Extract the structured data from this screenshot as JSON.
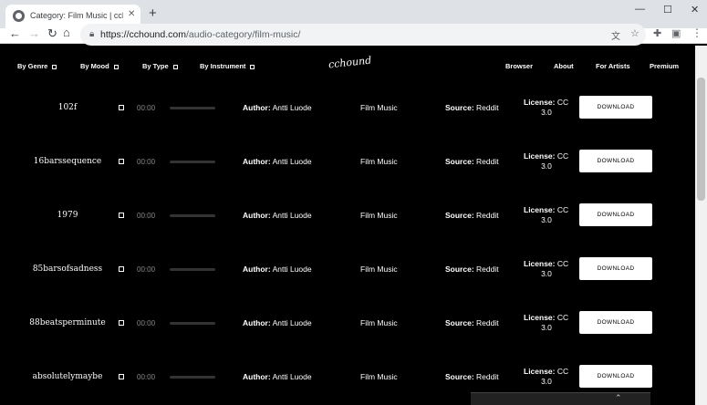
{
  "browser": {
    "tab_title": "Category: Film Music | cchound",
    "tab_close": "✕",
    "new_tab": "+",
    "url_host": "https://cchound.com",
    "url_path": "/audio-category/film-music/",
    "back": "←",
    "forward": "→",
    "reload": "↻",
    "home": "⌂",
    "minimize": "—",
    "maximize": "☐",
    "close": "✕",
    "translate_icon": "文",
    "star_icon": "☆",
    "extensions_icon": "✚",
    "profile_icon": "▣",
    "menu_icon": "⋮"
  },
  "site": {
    "logo": "cchound",
    "nav_left": [
      {
        "label": "By Genre"
      },
      {
        "label": "By Mood"
      },
      {
        "label": "By Type"
      },
      {
        "label": "By Instrument"
      }
    ],
    "nav_right": [
      {
        "label": "Browser"
      },
      {
        "label": "About"
      },
      {
        "label": "For Artists"
      },
      {
        "label": "Premium"
      }
    ],
    "tracks": [
      {
        "title": "102f",
        "time": "00:00",
        "author_label": "Author:",
        "author": "Antti Luode",
        "genre": "Film Music",
        "source_label": "Source:",
        "source": "Reddit",
        "license_label": "License:",
        "license": "CC",
        "license_ver": "3.0",
        "download": "DOWNLOAD"
      },
      {
        "title": "16barssequence",
        "time": "00:00",
        "author_label": "Author:",
        "author": "Antti Luode",
        "genre": "Film Music",
        "source_label": "Source:",
        "source": "Reddit",
        "license_label": "License:",
        "license": "CC",
        "license_ver": "3.0",
        "download": "DOWNLOAD"
      },
      {
        "title": "1979",
        "time": "00:00",
        "author_label": "Author:",
        "author": "Antti Luode",
        "genre": "Film Music",
        "source_label": "Source:",
        "source": "Reddit",
        "license_label": "License:",
        "license": "CC",
        "license_ver": "3.0",
        "download": "DOWNLOAD"
      },
      {
        "title": "85barsofsadness",
        "time": "00:00",
        "author_label": "Author:",
        "author": "Antti Luode",
        "genre": "Film Music",
        "source_label": "Source:",
        "source": "Reddit",
        "license_label": "License:",
        "license": "CC",
        "license_ver": "3.0",
        "download": "DOWNLOAD"
      },
      {
        "title": "88beatsperminute",
        "time": "00:00",
        "author_label": "Author:",
        "author": "Antti Luode",
        "genre": "Film Music",
        "source_label": "Source:",
        "source": "Reddit",
        "license_label": "License:",
        "license": "CC",
        "license_ver": "3.0",
        "download": "DOWNLOAD"
      },
      {
        "title": "absolutelymaybe",
        "time": "00:00",
        "author_label": "Author:",
        "author": "Antti Luode",
        "genre": "Film Music",
        "source_label": "Source:",
        "source": "Reddit",
        "license_label": "License:",
        "license": "CC",
        "license_ver": "3.0",
        "download": "DOWNLOAD"
      }
    ],
    "tray_icon": "⌃"
  }
}
